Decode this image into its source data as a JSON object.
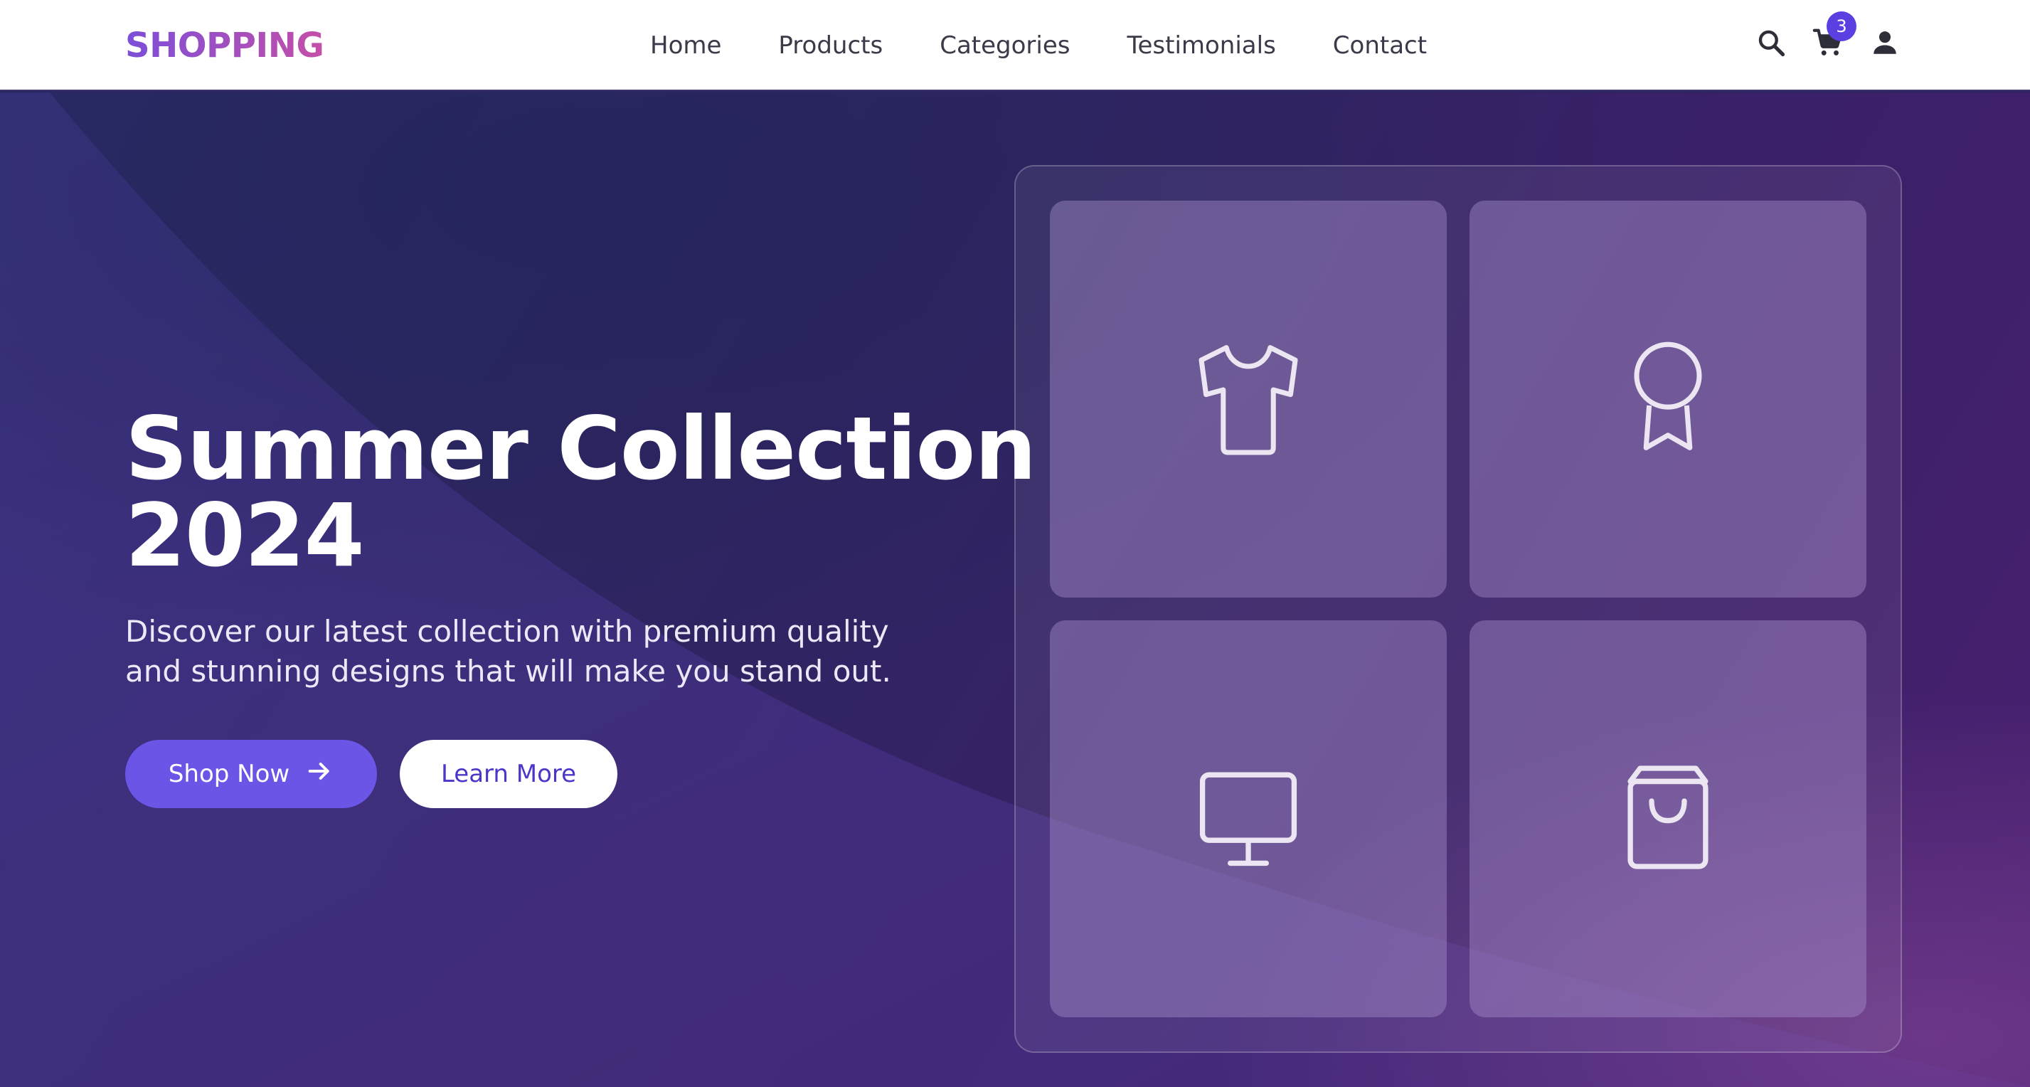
{
  "brand": {
    "name": "SHOPPING"
  },
  "nav": {
    "items": [
      {
        "label": "Home"
      },
      {
        "label": "Products"
      },
      {
        "label": "Categories"
      },
      {
        "label": "Testimonials"
      },
      {
        "label": "Contact"
      }
    ]
  },
  "header_actions": {
    "search_icon": "search-icon",
    "cart_icon": "cart-icon",
    "cart_count": "3",
    "account_icon": "user-icon"
  },
  "hero": {
    "title": "Summer Collection 2024",
    "description": "Discover our latest collection with premium quality and stunning designs that will make you stand out.",
    "primary_button": "Shop Now",
    "secondary_button": "Learn More"
  },
  "feature_tiles": [
    {
      "icon": "tshirt-icon"
    },
    {
      "icon": "award-ribbon-icon"
    },
    {
      "icon": "monitor-icon"
    },
    {
      "icon": "shopping-bag-icon"
    }
  ],
  "colors": {
    "accent": "#6a55e6",
    "badge": "#5b3fe0",
    "logo_gradient_start": "#7c4fd8",
    "logo_gradient_end": "#c44fa8",
    "hero_background": "#2f2562"
  }
}
